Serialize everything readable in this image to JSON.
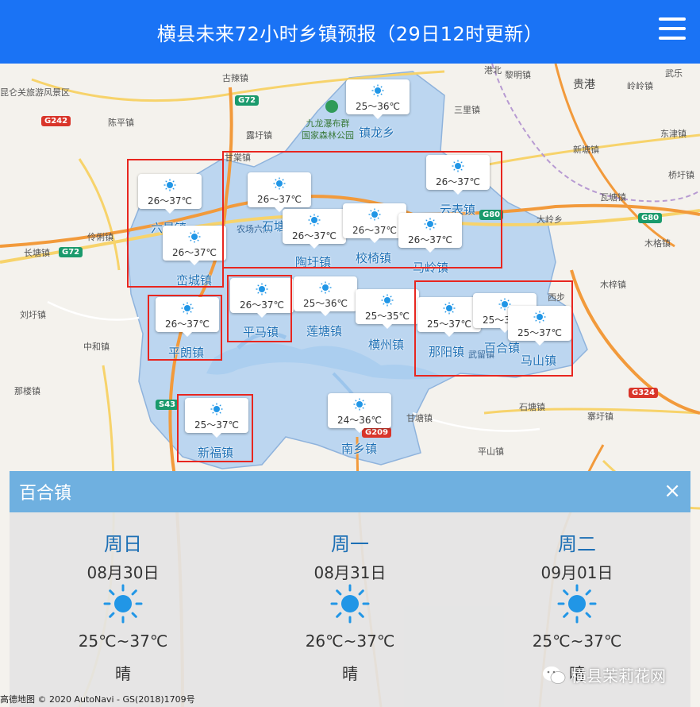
{
  "header": {
    "title": "横县未来72小时乡镇预报（29日12时更新）"
  },
  "icons": {
    "menu": "hamburger-menu-icon",
    "weather": "sunny-icon",
    "close": "close-icon"
  },
  "colors": {
    "header": "#1a73f5",
    "town_label": "#1c6fb5",
    "highlight": "#e8261f",
    "panel_head": "#6fb0e0",
    "sun": "#2196e6",
    "county": "#bcd6f0"
  },
  "map": {
    "places": {
      "kunlun": "昆仑关旅游风景区",
      "gudai": "古辣镇",
      "chenping": "陈平镇",
      "lutang": "露圩镇",
      "ganmao": "甘棠镇",
      "lingli": "伶俐镇",
      "changtang": "长塘镇",
      "liuxu": "刘圩镇",
      "zhonghe": "中和镇",
      "nalou": "那楼镇",
      "gangbei": "港北",
      "guigang": "贵港",
      "lingjiang": "岭岭镇",
      "wule": "武乐",
      "liming": "黎明镇",
      "sanli": "三里镇",
      "xintang": "新塘镇",
      "dongjin": "东津镇",
      "qiaoxu": "桥圩镇",
      "wajiang": "瓦塘镇",
      "dalingxiang": "大岭乡",
      "muge": "木格镇",
      "muzi": "木梓镇",
      "shitang_south": "石塘镇",
      "ganma": "甘塘镇",
      "pingshan": "平山镇",
      "zhaoxu": "寨圩镇",
      "jiulong": "九龙瀑布群\n国家森林公园",
      "nongchang": "农场六队",
      "wuliu": "武留镇",
      "tongyi": "西步"
    },
    "roads": {
      "g72a": "G72",
      "g72b": "G72",
      "g242": "G242",
      "g80a": "G80",
      "g80b": "G80",
      "s43": "S43",
      "g209": "G209",
      "g324": "G324"
    },
    "stations": [
      {
        "name": "镇龙乡",
        "temp": "25～36℃"
      },
      {
        "name": "六景镇",
        "temp": "26～37℃"
      },
      {
        "name": "石塘镇",
        "temp": "26～37℃"
      },
      {
        "name": "陶圩镇",
        "temp": "26～37℃"
      },
      {
        "name": "校椅镇",
        "temp": "26～37℃"
      },
      {
        "name": "云表镇",
        "temp": "26～37℃"
      },
      {
        "name": "马岭镇",
        "temp": "26～37℃"
      },
      {
        "name": "峦城镇",
        "temp": "26～37℃"
      },
      {
        "name": "平马镇",
        "temp": "26～37℃"
      },
      {
        "name": "莲塘镇",
        "temp": "25～36℃"
      },
      {
        "name": "横州镇",
        "temp": "25～35℃"
      },
      {
        "name": "平朗镇",
        "temp": "26～37℃"
      },
      {
        "name": "那阳镇",
        "temp": "25～37℃"
      },
      {
        "name": "百合镇",
        "temp": "25～3"
      },
      {
        "name": "马山镇",
        "temp": "25～37℃"
      },
      {
        "name": "新福镇",
        "temp": "25～37℃"
      },
      {
        "name": "南乡镇",
        "temp": "24～36℃"
      }
    ]
  },
  "panel": {
    "town": "百合镇",
    "close_label": "×",
    "days": [
      {
        "weekday": "周日",
        "date": "08月30日",
        "temp": "25℃~37℃",
        "weather": "晴"
      },
      {
        "weekday": "周一",
        "date": "08月31日",
        "temp": "26℃~37℃",
        "weather": "晴"
      },
      {
        "weekday": "周二",
        "date": "09月01日",
        "temp": "25℃~37℃",
        "weather": "晴"
      }
    ]
  },
  "footer": {
    "map_logo": "高德地图",
    "copyright": "© 2020 AutoNavi - GS(2018)1709号",
    "watermark": "横县茉莉花网"
  }
}
